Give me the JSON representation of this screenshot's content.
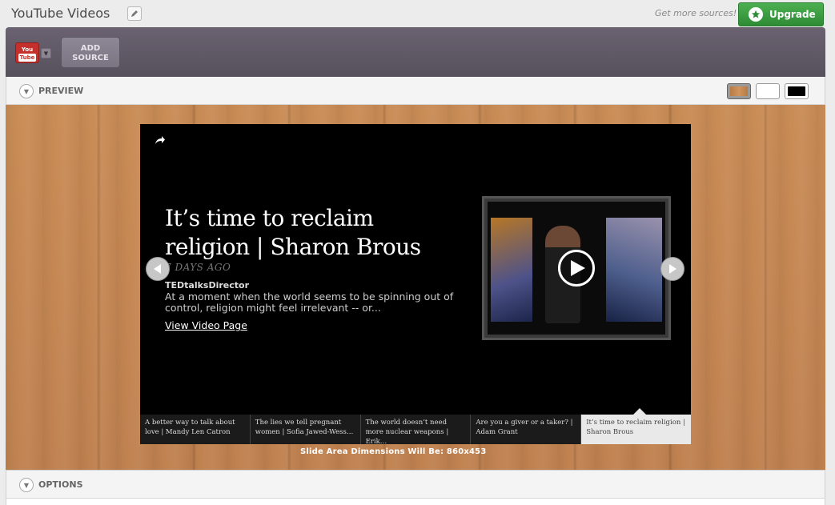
{
  "header": {
    "title": "YouTube Videos",
    "get_more_sources": "Get more sources!",
    "upgrade_label": "Upgrade"
  },
  "source_bar": {
    "source_logo_top": "You",
    "source_logo_bottom": "Tube",
    "add_source_line1": "ADD",
    "add_source_line2": "SOURCE"
  },
  "preview": {
    "section_label": "PREVIEW",
    "background_swatches": [
      {
        "name": "wood",
        "color": "#c08250"
      },
      {
        "name": "white",
        "color": "#ffffff"
      },
      {
        "name": "black",
        "color": "#000000"
      }
    ],
    "selected_swatch": "wood"
  },
  "slide": {
    "title": "It’s time to reclaim religion | Sharon Brous",
    "date": "7 DAYS AGO",
    "author": "TEDtalksDirector",
    "description": "At a moment when the world seems to be spinning out of control, religion might feel irrelevant -- or...",
    "view_link": "View Video Page"
  },
  "strip": [
    "A better way to talk about love | Mandy Len Catron",
    "The lies we tell pregnant women | Sofia Jawed-Wess…",
    "The world doesn’t need more nuclear weapons | Erik…",
    "Are you a giver or a taker? | Adam Grant",
    "It’s time to reclaim religion | Sharon Brous"
  ],
  "strip_active_index": 4,
  "dimensions_text": "Slide Area Dimensions Will Be: 860x453",
  "options": {
    "section_label": "OPTIONS"
  },
  "colors": {
    "upgrade_green": "#2e8b35",
    "toolbar_purple": "#5f5865",
    "youtube_red": "#c4302b"
  }
}
